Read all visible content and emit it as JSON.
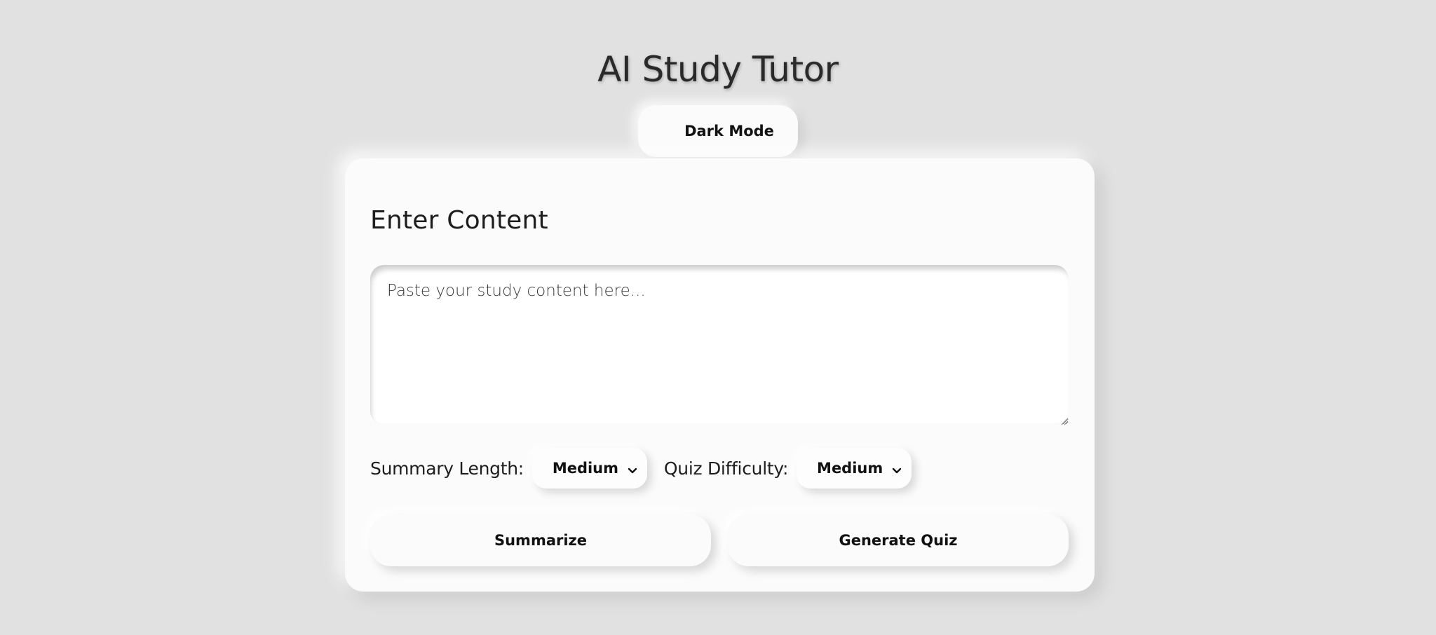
{
  "page": {
    "title": "AI Study Tutor"
  },
  "theme_toggle": {
    "icon": "moon-icon",
    "label": "Dark Mode"
  },
  "content_card": {
    "heading": "Enter Content",
    "textarea": {
      "value": "",
      "placeholder": "Paste your study content here..."
    },
    "summary_length": {
      "label": "Summary Length:",
      "selected": "Medium"
    },
    "quiz_difficulty": {
      "label": "Quiz Difficulty:",
      "selected": "Medium"
    },
    "summarize_label": "Summarize",
    "generate_quiz_label": "Generate Quiz"
  },
  "colors": {
    "background": "#e1e1e1",
    "surface": "#fbfbfb",
    "text": "#1b1b1b",
    "moon": "#f2b24c"
  }
}
